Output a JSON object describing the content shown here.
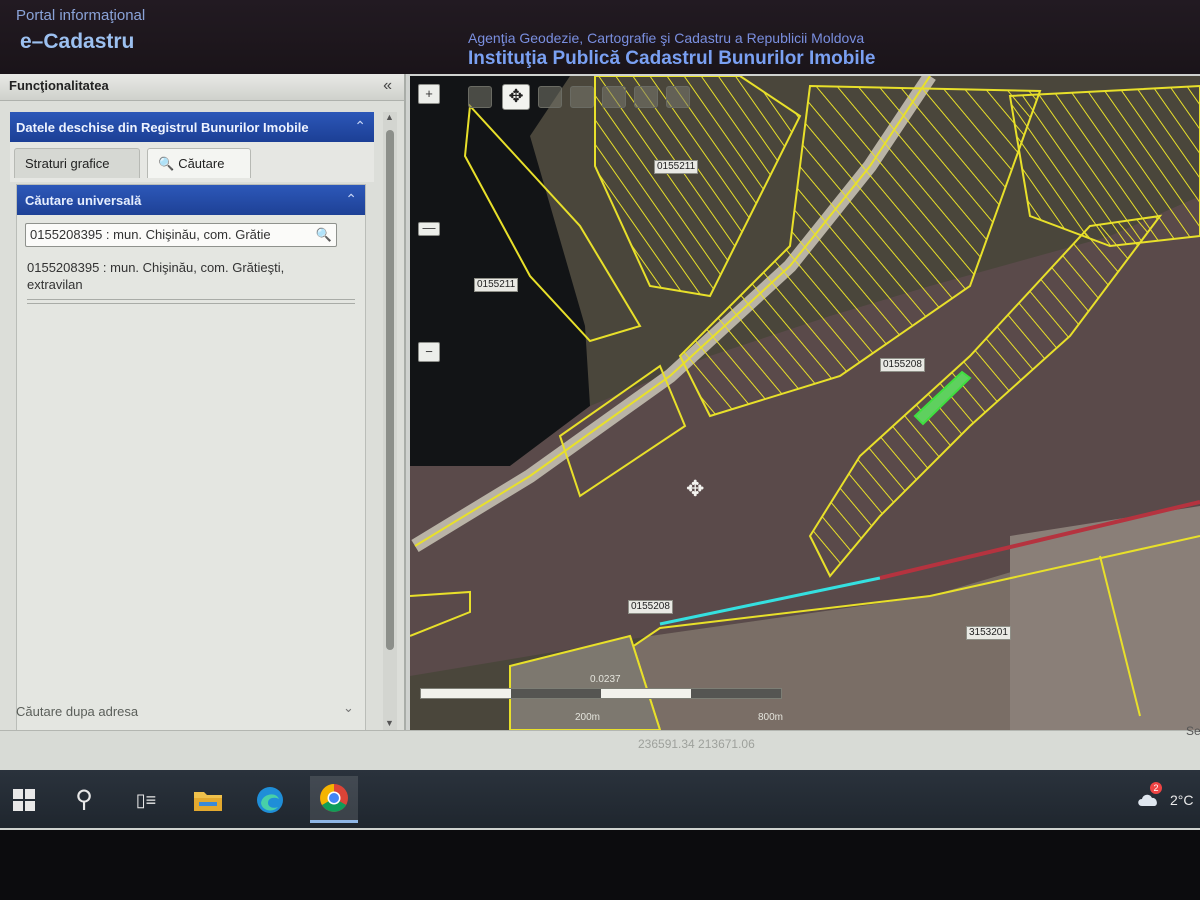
{
  "header": {
    "portal_text": "Portal informaţional",
    "app_name": "e–Cadastru",
    "agency": "Agenţia Geodezie, Cartografie şi Cadastru a Republicii Moldova",
    "institution": "Instituţia Publică Cadastrul Bunurilor Imobile"
  },
  "left_panel": {
    "title": "Funcţionalitatea",
    "collapse_symbol": "«",
    "accordion_title": "Datele deschise din Registrul Bunurilor Imobile",
    "tabs": [
      {
        "label": "Straturi grafice"
      },
      {
        "label": "Căutare"
      }
    ],
    "search_section_title": "Căutare universală",
    "search_value": "0155208395 : mun. Chişinău, com. Grătie",
    "result_line1": "0155208395 : mun. Chişinău, com. Grătieşti,",
    "result_line2": "extravilan",
    "address_search": "Căutare dupa adresa"
  },
  "map": {
    "parcel_labels": [
      "0155211",
      "0155211",
      "0155208",
      "3153201",
      "0155208"
    ],
    "zoom_in": "+",
    "zoom_slider": "—",
    "zoom_out": "−",
    "scale_labels": [
      "0.0237",
      "200m",
      "800m"
    ]
  },
  "status": {
    "coordinates": "236591.34   213671.06",
    "right_text": "Se"
  },
  "taskbar": {
    "icons": [
      "windows-start-icon",
      "search-icon",
      "task-view-icon",
      "file-explorer-icon",
      "edge-icon",
      "chrome-icon"
    ],
    "weather_badge": "2",
    "temperature": "2°C"
  },
  "colors": {
    "header_bg": "#1a1419",
    "accent_blue": "#1e4196",
    "parcel_outline": "#e8e02a",
    "selected_parcel": "#3fe03f",
    "boundary_cyan": "#35e0e0",
    "boundary_red": "#b5333f"
  }
}
